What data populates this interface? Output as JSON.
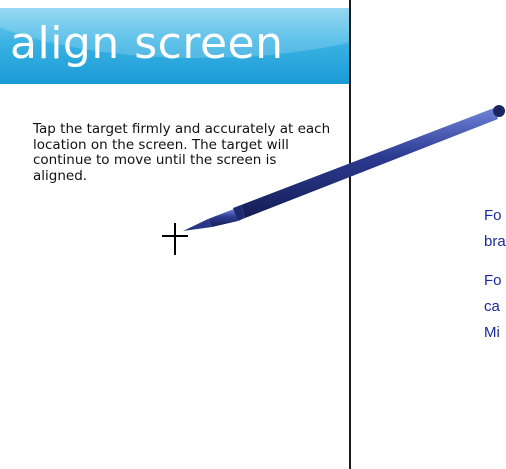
{
  "screen": {
    "title": "align screen",
    "instructions": "Tap the target firmly and accurately at each location on the screen. The target will continue to move until the screen is aligned."
  },
  "side_text": {
    "line1": "Fo",
    "line2": "bra",
    "line3": "Fo",
    "line4": "ca",
    "line5": "Mi"
  },
  "icons": {
    "target": "crosshair-target-icon",
    "stylus": "stylus-pen-icon"
  },
  "colors": {
    "header_light": "#7fd0ef",
    "header_dark": "#1a9ad5",
    "side_text": "#1a2a9c",
    "stylus": "#2b3a8f"
  }
}
